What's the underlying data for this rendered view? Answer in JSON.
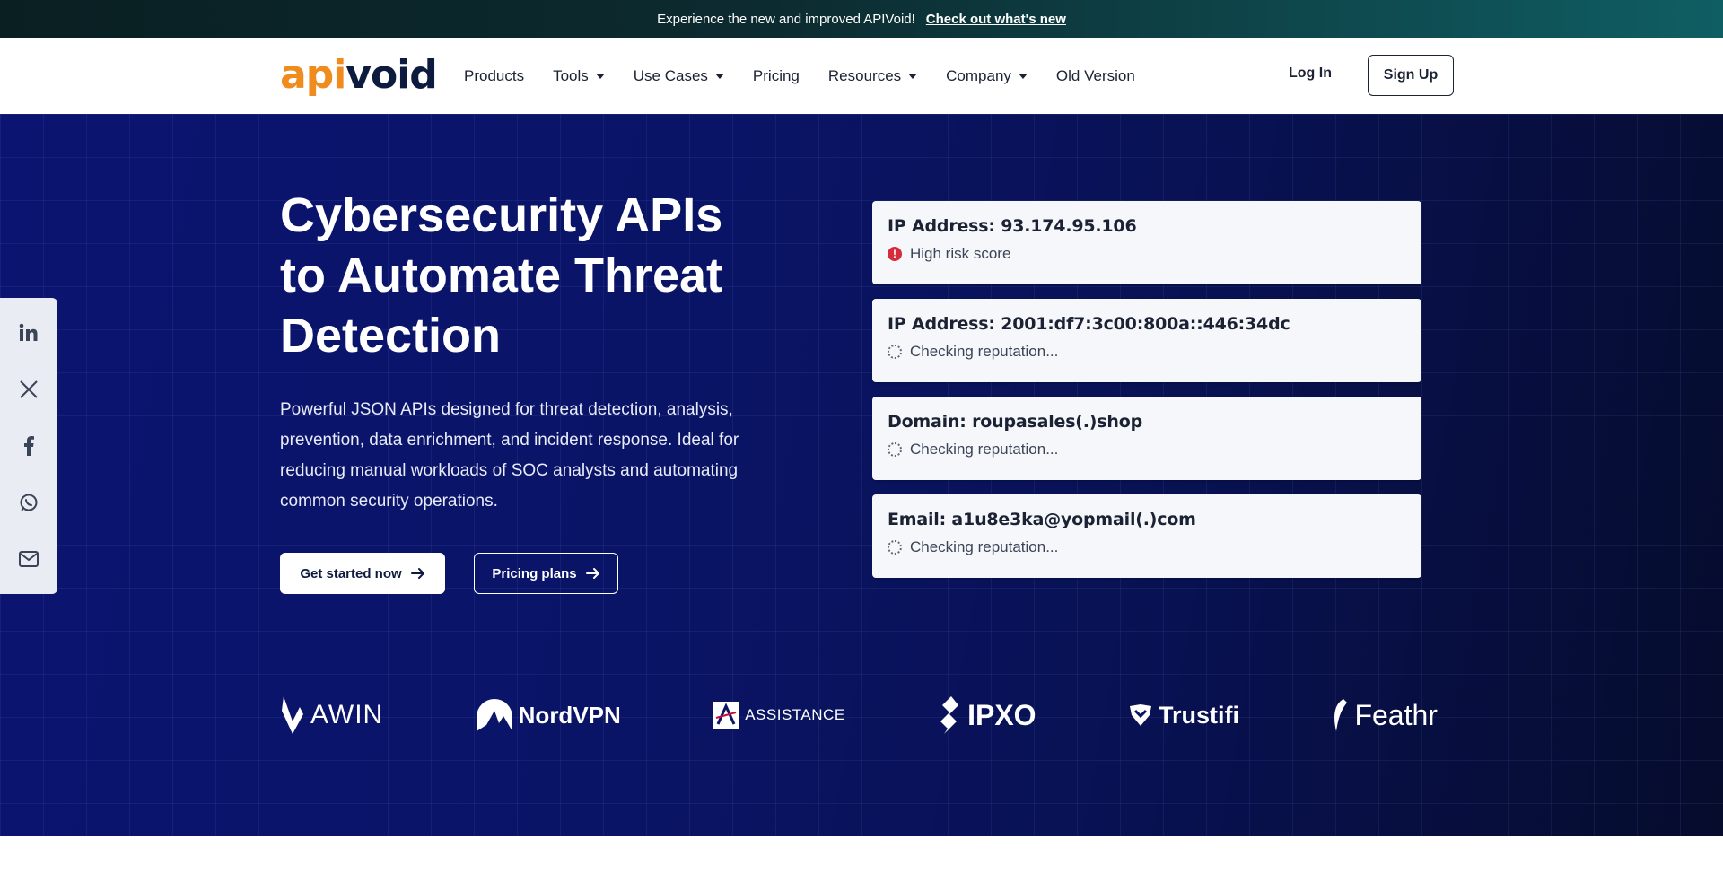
{
  "announcement": {
    "text": " Experience the new and improved APIVoid!",
    "link": "Check out what's new"
  },
  "nav": {
    "logo_api": "api",
    "logo_void": "void",
    "items": [
      {
        "label": "Products",
        "dropdown": false
      },
      {
        "label": "Tools",
        "dropdown": true
      },
      {
        "label": "Use Cases",
        "dropdown": true
      },
      {
        "label": "Pricing",
        "dropdown": false
      },
      {
        "label": "Resources",
        "dropdown": true
      },
      {
        "label": "Company",
        "dropdown": true
      },
      {
        "label": "Old Version",
        "dropdown": false
      }
    ],
    "login": "Log In",
    "signup": "Sign Up"
  },
  "hero": {
    "title_line1": "Cybersecurity APIs",
    "title_line2": "to Automate Threat",
    "title_line3": "Detection",
    "description": "Powerful JSON APIs designed for threat detection, analysis, prevention, data enrichment, and incident response. Ideal for reducing manual workloads of SOC analysts and automating common security operations.",
    "cta_primary": "Get started now",
    "cta_secondary": "Pricing plans"
  },
  "checks": [
    {
      "title": "IP Address: 93.174.95.106",
      "status": "High risk score",
      "state": "risk"
    },
    {
      "title": "IP Address: 2001:df7:3c00:800a::446:34dc",
      "status": "Checking reputation...",
      "state": "loading"
    },
    {
      "title": "Domain: roupasales(.)shop",
      "status": "Checking reputation...",
      "state": "loading"
    },
    {
      "title": "Email: a1u8e3ka@yopmail(.)com",
      "status": "Checking reputation...",
      "state": "loading"
    }
  ],
  "brands": [
    "AWIN",
    "NordVPN",
    "ASSISTANCE",
    "IPXO",
    "Trustifi",
    "Feathr"
  ],
  "social": [
    "linkedin-icon",
    "x-icon",
    "facebook-icon",
    "whatsapp-icon",
    "mail-icon"
  ],
  "colors": {
    "accent_orange": "#f08c1e",
    "navy": "#0d1b3e",
    "hero_bg": "#0a1466",
    "risk_red": "#d62b3a"
  }
}
